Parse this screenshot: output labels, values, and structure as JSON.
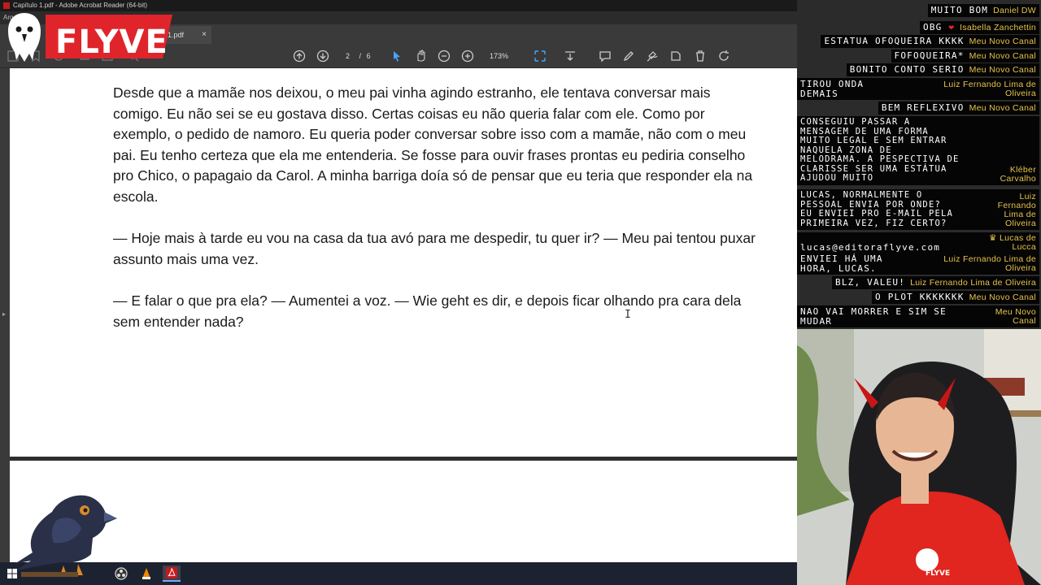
{
  "window": {
    "title": "Capítulo 1.pdf - Adobe Acrobat Reader (64-bit)",
    "menu_fragment": "Arq"
  },
  "tabs": [
    {
      "label": "1.pdf",
      "close": "×"
    }
  ],
  "toolbar": {
    "page_current": "2",
    "page_sep": "/",
    "page_total": "6",
    "zoom": "173%",
    "zoom_caret": "▾"
  },
  "logo": {
    "text": "FLYVE"
  },
  "document": {
    "paragraphs": [
      "Desde que a mamãe nos deixou, o meu pai vinha agindo estranho, ele tentava conversar mais comigo. Eu não sei se eu gostava disso. Certas coisas eu não queria falar com ele. Como por exemplo, o pedido de namoro. Eu queria poder conversar sobre isso com a mamãe, não com o meu pai. Eu tenho certeza que ela me entenderia. Se fosse para ouvir frases prontas eu pediria conselho pro Chico, o papagaio da Carol. A minha barriga doía só de pensar que eu teria que responder ela na escola.",
      "— Hoje mais à tarde eu vou na casa da tua avó para me despedir, tu quer ir? — Meu pai tentou puxar assunto mais uma vez.",
      "— E falar o que pra ela? — Aumentei a voz. — Wie geht es dir, e depois ficar olhando pra cara dela sem entender nada?"
    ]
  },
  "chat": [
    {
      "msg": "MUITO BOM",
      "user": "Daniel DW"
    },
    {
      "msg": "OBG",
      "heart": "❤",
      "user": "Isabella Zanchettin"
    },
    {
      "msg": "ESTATUA OFOQUEIRA KKKK",
      "user": "Meu Novo Canal"
    },
    {
      "msg": "FOFOQUEIRA*",
      "user": "Meu Novo Canal"
    },
    {
      "msg": "BONITO CONTO SERIO",
      "user": "Meu Novo Canal"
    },
    {
      "msg": "TIROU ONDA\nDEMAIS",
      "user": "Luiz Fernando Lima de Oliveira"
    },
    {
      "msg": "BEM REFLEXIVO",
      "user": "Meu Novo Canal"
    },
    {
      "msg": "Conseguiu passar a\nmensagem de uma forma\nmuito legal e sem entrar\nnaquela zona de\nmelodrama. A pespectiva de\nClarisse ser uma estátua\najudou muito",
      "user": "Kléber Carvalho"
    },
    {
      "msg": "Lucas, normalmente o\npessoal envia por onde?\nEu enviei pro e-mail pela\nprimeira vez, fiz certo?",
      "user": "Luiz Fernando Lima de Oliveira"
    },
    {
      "msg": "lucas@editoraflyve.com",
      "user": "Lucas de Lucca"
    },
    {
      "msg": "Enviei há uma\nhora, Lucas.",
      "user": "Luiz Fernando Lima de Oliveira"
    },
    {
      "msg": "Blz, valeu!",
      "user": "Luiz Fernando Lima de Oliveira"
    },
    {
      "msg": "O PLOT KKKKKKK",
      "user": "Meu Novo Canal"
    },
    {
      "msg": "NAO VAI MORRER E SIM SE\nMUDAR",
      "user": "Meu Novo Canal"
    }
  ],
  "webcam": {
    "shirt_logo": "FLYVE"
  }
}
